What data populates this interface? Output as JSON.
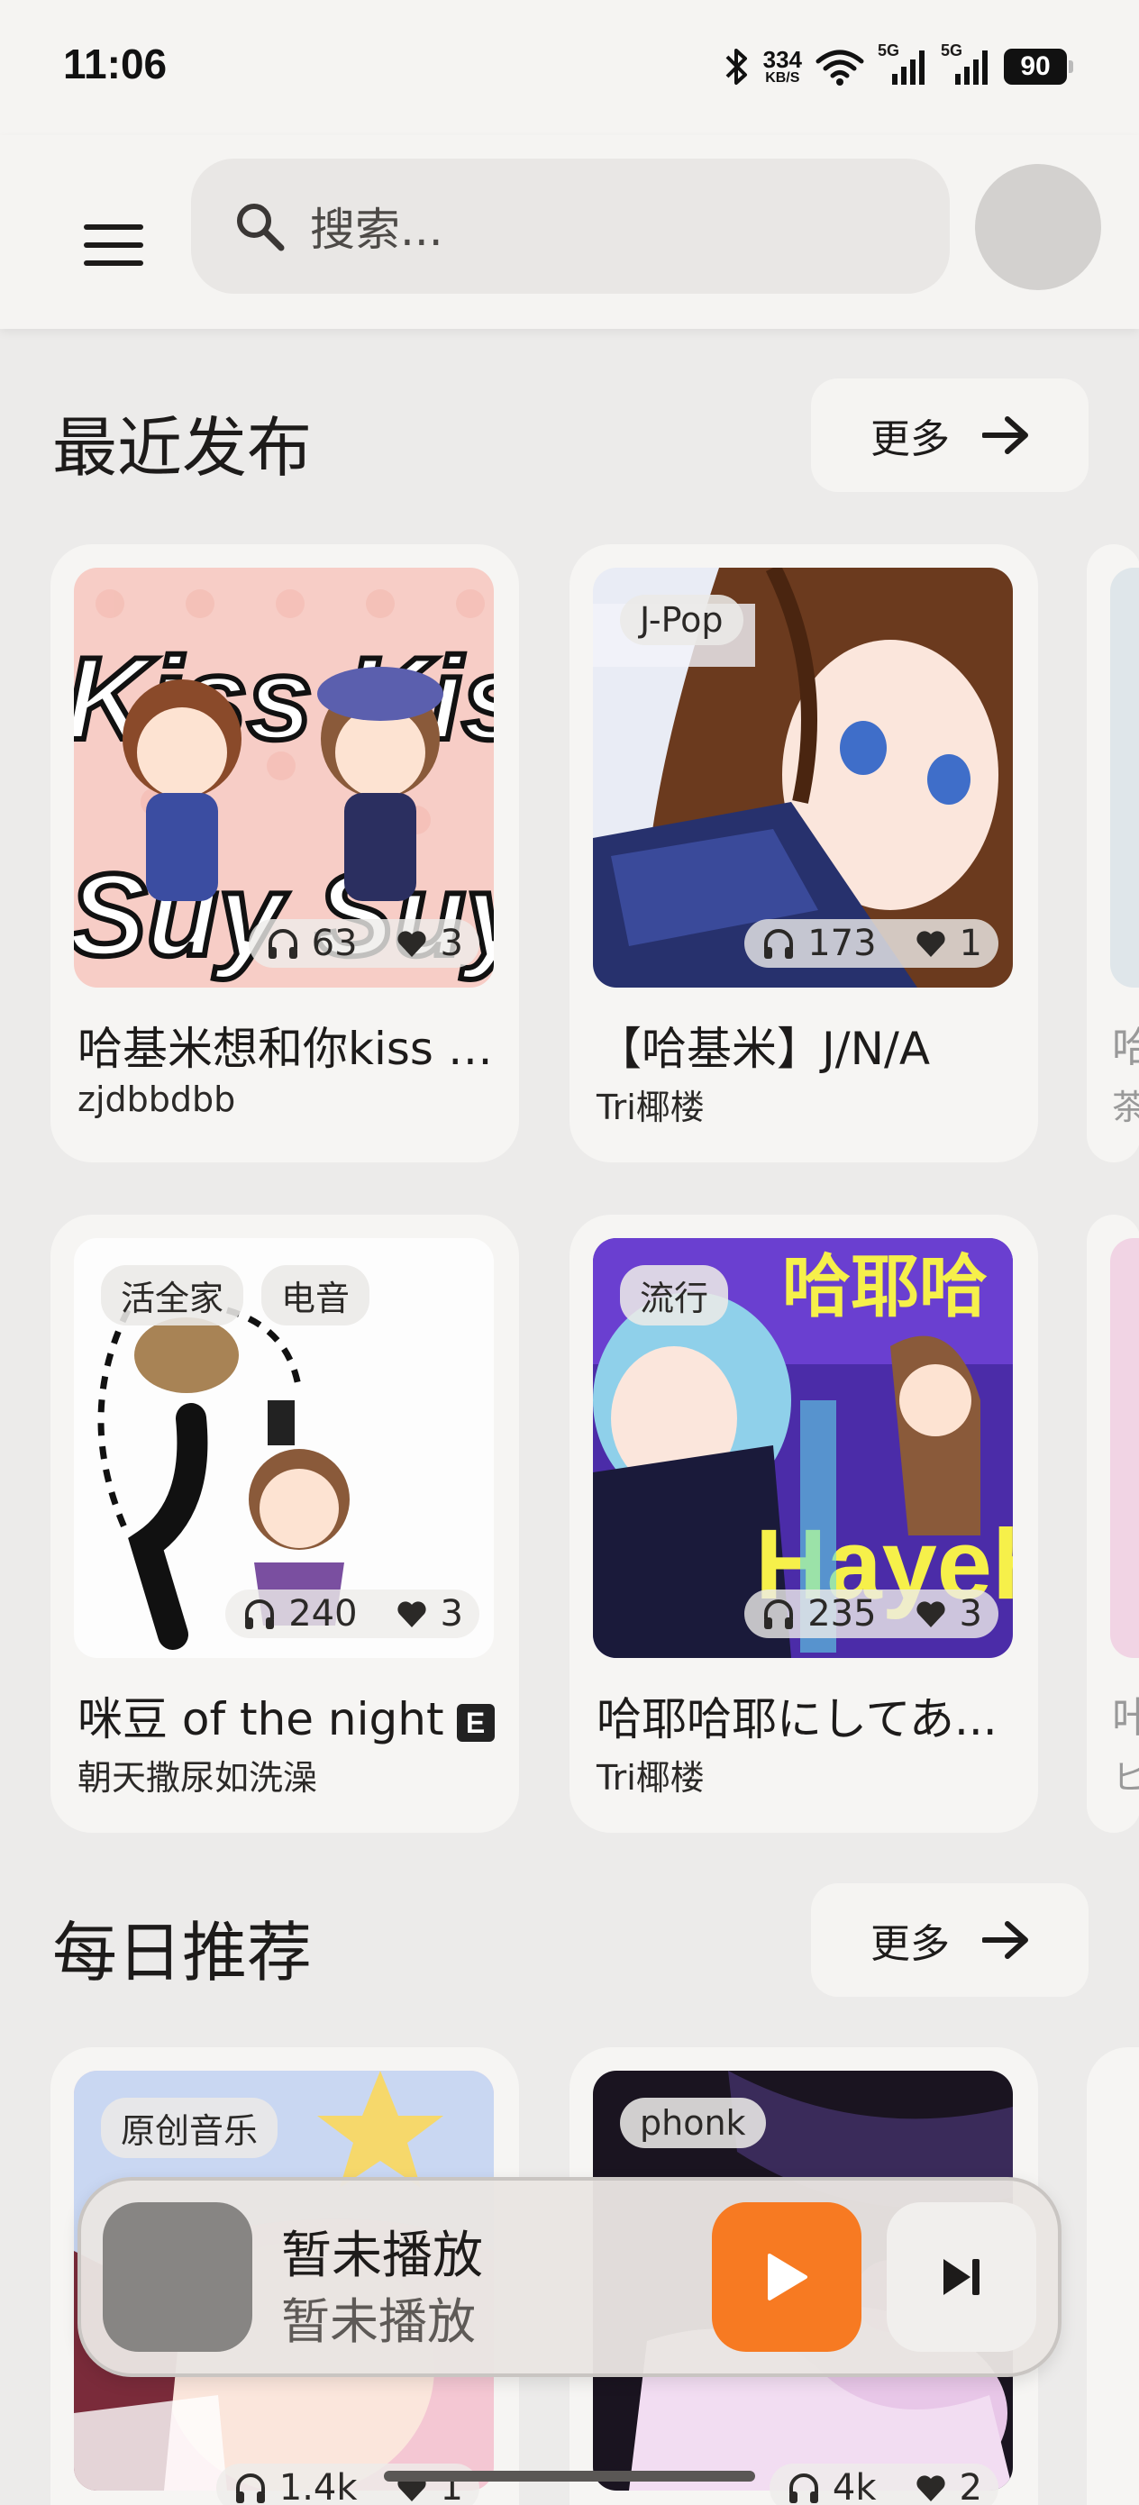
{
  "status_bar": {
    "time": "11:06",
    "net_speed_value": "334",
    "net_speed_unit": "KB/S",
    "signal_1": "5G",
    "signal_2": "5G",
    "battery": "90"
  },
  "top_bar": {
    "search_placeholder": "搜索..."
  },
  "sections": [
    {
      "title": "最近发布",
      "more_label": "更多",
      "cards": [
        {
          "title": "哈基米想和你kiss k...",
          "author": "zjdbbdbb",
          "tags": [],
          "plays": "63",
          "likes": "3",
          "explicit": false
        },
        {
          "title": "【哈基米】J/N/A",
          "author": "Tri椰楼",
          "tags": [
            "J-Pop"
          ],
          "plays": "173",
          "likes": "1",
          "explicit": false
        },
        {
          "title": "咪豆 of the night",
          "author": "朝天撒尿如洗澡",
          "tags": [
            "活全家",
            "电音"
          ],
          "plays": "240",
          "likes": "3",
          "explicit": true,
          "explicit_label": "E"
        },
        {
          "title": "哈耶哈耶にしてあ...",
          "author": "Tri椰楼",
          "tags": [
            "流行"
          ],
          "plays": "235",
          "likes": "3",
          "explicit": false
        }
      ]
    },
    {
      "title": "每日推荐",
      "more_label": "更多",
      "cards": [
        {
          "title": "",
          "author": "",
          "tags": [
            "原创音乐"
          ],
          "plays": "1.4k",
          "likes": "1",
          "explicit": false
        },
        {
          "title": "",
          "author": "",
          "tags": [
            "phonk"
          ],
          "plays": "4k",
          "likes": "2",
          "explicit": false
        }
      ]
    }
  ],
  "cover_texts": {
    "card1_art": "Kiss Kiss",
    "card1_art2": "Suy Suy",
    "card4_art": "哈耶哈",
    "card4_art2": "Hayeh"
  },
  "peek_texts": [
    "哈",
    "茶",
    "咔",
    "ヒ"
  ],
  "player": {
    "title": "暂未播放",
    "subtitle": "暂未播放",
    "accent": "#f77a22"
  },
  "icons": {
    "menu": "menu-icon",
    "search": "search-icon",
    "more": "arrow-right-icon",
    "plays": "headphones-icon",
    "likes": "heart-icon",
    "play": "play-icon",
    "next": "skip-next-icon"
  }
}
